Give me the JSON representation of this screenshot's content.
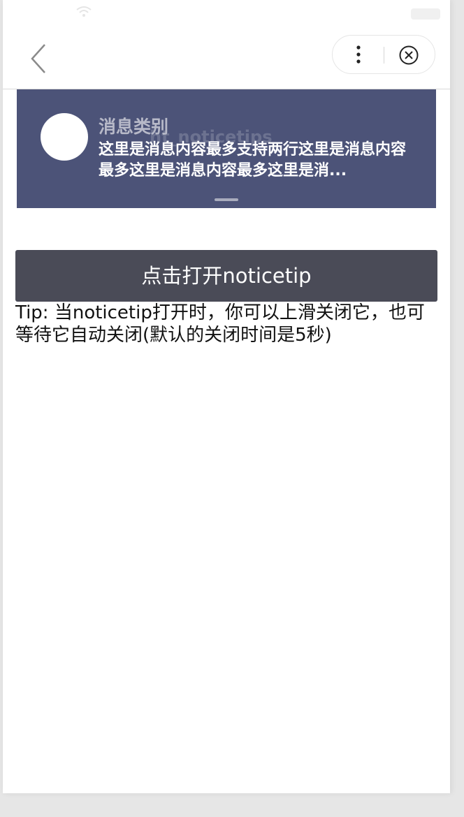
{
  "nav": {
    "back_icon": "chevron-left-icon",
    "more_icon": "more-vertical-icon",
    "close_icon": "close-circle-icon"
  },
  "notice": {
    "background_title": "ht_noticetips",
    "category": "消息类别",
    "content": "这里是消息内容最多支持两行这里是消息内容最多这里是消息内容最多这里是消...",
    "bg_color": "#4c5378"
  },
  "main": {
    "open_button_label": "点击打开noticetip",
    "tip": "Tip: 当noticetip打开时，你可以上滑关闭它，也可等待它自动关闭(默认的关闭时间是5秒)"
  }
}
